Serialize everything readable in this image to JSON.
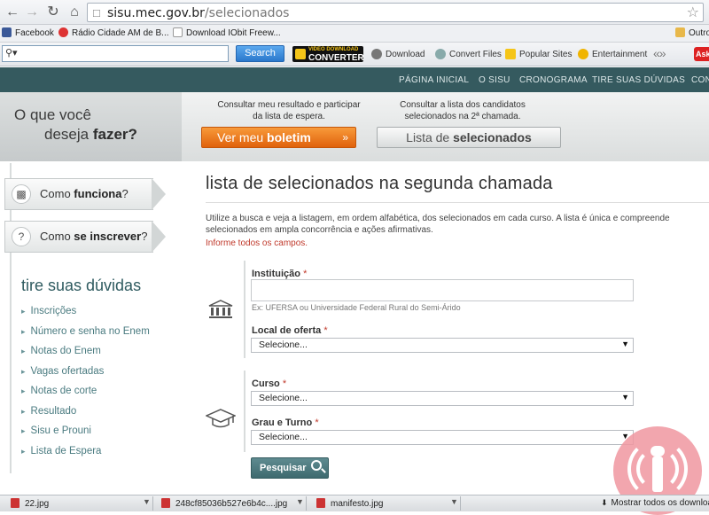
{
  "browser": {
    "url_host": "sisu.mec.gov.br",
    "url_path": "/selecionados",
    "bookmarks": [
      "Facebook",
      "Rádio Cidade AM de B...",
      "Download IObit Freew...",
      "Outro"
    ],
    "toolbar": {
      "search_button": "Search",
      "vdc_small": "VIDEO DOWNLOAD",
      "vdc_big": "CONVERTER",
      "items": [
        "Download",
        "Convert Files",
        "Popular Sites",
        "Entertainment"
      ],
      "ask": "Ask"
    }
  },
  "site_nav": [
    "PÁGINA INICIAL",
    "O SISU",
    "CRONOGRAMA",
    "TIRE SUAS DÚVIDAS",
    "CONS"
  ],
  "hero": {
    "question_line1": "O que você",
    "question_line2_prefix": "deseja ",
    "question_line2_bold": "fazer?",
    "left_text_line1": "Consultar meu resultado e participar",
    "left_text_line2": "da lista de espera.",
    "right_text_line1": "Consultar a lista dos candidatos",
    "right_text_line2": "selecionados na 2ª chamada.",
    "boletim_prefix": "Ver meu ",
    "boletim_bold": "boletim",
    "boletim_arrow": "»",
    "lista_prefix": "Lista de ",
    "lista_bold": "selecionados"
  },
  "sidebar": {
    "tab1_prefix": "Como ",
    "tab1_bold": "funciona",
    "tab1_suffix": "?",
    "tab2_prefix": "Como ",
    "tab2_bold": "se inscrever",
    "tab2_suffix": "?",
    "faq_title": "tire suas dúvidas",
    "faq_items": [
      "Inscrições",
      "Número e senha no Enem",
      "Notas do Enem",
      "Vagas ofertadas",
      "Notas de corte",
      "Resultado",
      "Sisu e Prouni",
      "Lista de Espera"
    ]
  },
  "main": {
    "title": "lista de selecionados na segunda chamada",
    "intro": "Utilize a busca e veja a listagem, em ordem alfabética, dos selecionados em cada curso. A lista é única e compreende selecionados em ampla concorrência e ações afirmativas.",
    "required_note": "Informe todos os campos.",
    "instituicao_label": "Instituição",
    "instituicao_hint": "Ex: UFERSA ou Universidade Federal Rural do Semi-Árido",
    "local_label": "Local de oferta",
    "curso_label": "Curso",
    "grau_label": "Grau e Turno",
    "select_placeholder": "Selecione...",
    "asterisk": "*",
    "search_button": "Pesquisar"
  },
  "downloads": {
    "files": [
      "22.jpg",
      "248cf85036b527e6b4c....jpg",
      "manifesto.jpg"
    ],
    "show_all": "Mostrar todos os downloads..."
  },
  "colors": {
    "site_nav_bg": "#355a5f",
    "accent_orange": "#e8700f",
    "link_teal": "#4a7b80",
    "required_red": "#c0392b"
  }
}
